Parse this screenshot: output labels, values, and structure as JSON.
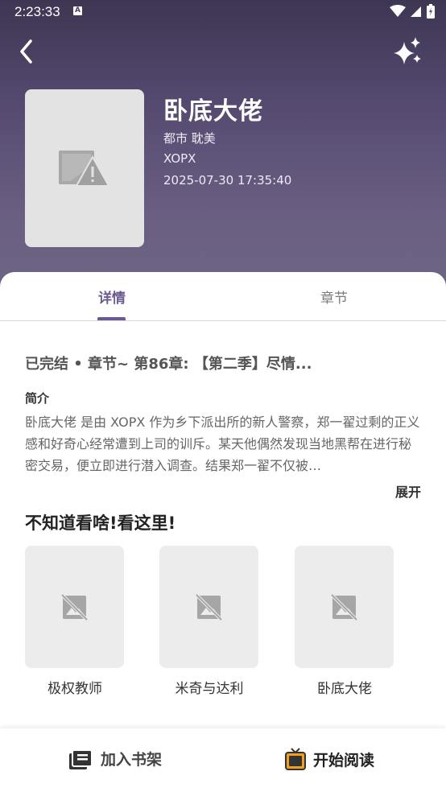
{
  "status_bar": {
    "time": "2:23:33",
    "indicator": "A"
  },
  "header": {
    "back_icon": "chevron-left-icon",
    "action_icon": "sparkle-icon"
  },
  "book": {
    "title": "卧底大佬",
    "tags": "都市 耽美",
    "author": "XOPX",
    "updated": "2025-07-30 17:35:40",
    "cover_icon": "broken-image-warning-icon"
  },
  "tabs": [
    {
      "label": "详情",
      "active": true
    },
    {
      "label": "章节",
      "active": false
    }
  ],
  "details": {
    "status_line": "已完结 • 章节~ 第86章: 【第二季】尽情...",
    "intro_title": "简介",
    "intro_text": "卧底大佬 是由 XOPX 作为乡下派出所的新人警察，郑一翟过剩的正义感和好奇心经常遭到上司的训斥。某天他偶然发现当地黑帮在进行秘密交易，便立即进行潜入调查。结果郑一翟不仅被…",
    "expand_label": "展开"
  },
  "recommendations": {
    "title": "不知道看啥!看这里!",
    "items": [
      {
        "label": "极权教师"
      },
      {
        "label": "米奇与达利"
      },
      {
        "label": "卧底大佬"
      }
    ]
  },
  "bottom_bar": {
    "shelf_label": "加入书架",
    "read_label": "开始阅读"
  },
  "colors": {
    "accent": "#6b5a92",
    "header_top": "#3e3652",
    "header_bottom": "#6f6583",
    "read_icon": "#f0a020"
  }
}
